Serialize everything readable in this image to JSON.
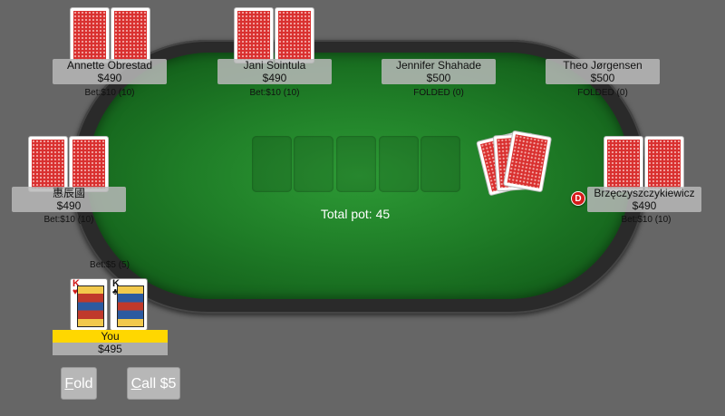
{
  "table": {
    "pot_label": "Total pot: 45",
    "dealer_label": "D"
  },
  "players": [
    {
      "name": "Annette Obrestad",
      "chips": "$490",
      "status": "Bet:$10 (10)"
    },
    {
      "name": "Jani Sointula",
      "chips": "$490",
      "status": "Bet:$10 (10)"
    },
    {
      "name": "Jennifer Shahade",
      "chips": "$500",
      "status": "FOLDED (0)"
    },
    {
      "name": "Theo Jørgensen",
      "chips": "$500",
      "status": "FOLDED (0)"
    },
    {
      "name": "惠辰國",
      "chips": "$490",
      "status": "Bet:$10 (10)"
    },
    {
      "name": "Brzęczyszczykiewicz",
      "chips": "$490",
      "status": "Bet:$10 (10)"
    }
  ],
  "hero": {
    "name": "You",
    "chips": "$495",
    "status": "Bet:$5 (5)",
    "cards": [
      {
        "rank": "K",
        "suit": "♥",
        "color": "#d01818"
      },
      {
        "rank": "K",
        "suit": "♣",
        "color": "#111111"
      }
    ]
  },
  "actions": {
    "fold_hotkey": "F",
    "fold_rest": "old",
    "call_hotkey": "C",
    "call_rest": "all $5"
  }
}
